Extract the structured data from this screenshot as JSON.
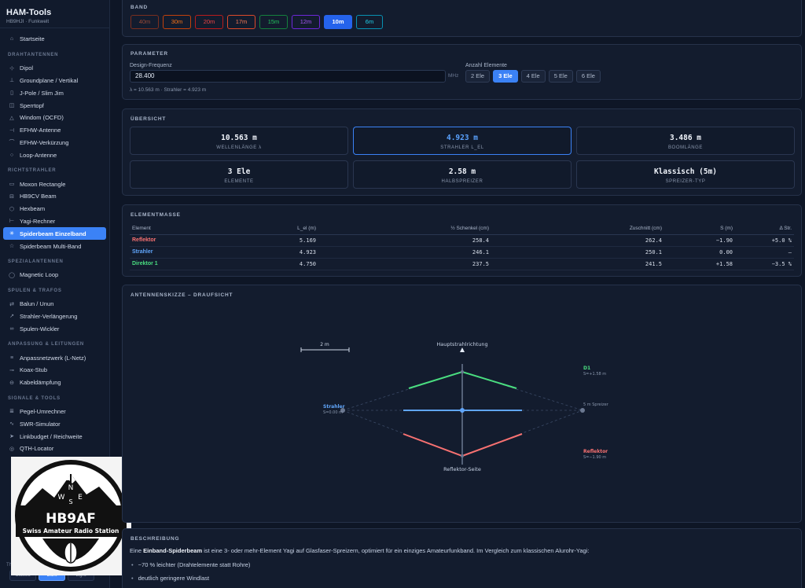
{
  "app": {
    "title": "HAM-Tools",
    "subtitle": "HB9HJI · Funkwelt"
  },
  "sidebar": {
    "home": "Startseite",
    "sections": [
      {
        "title": "DRAHTANTENNEN",
        "items": [
          {
            "label": "Dipol",
            "icon": "dipole-icon",
            "glyph": "⊹"
          },
          {
            "label": "Groundplane / Vertikal",
            "icon": "groundplane-icon",
            "glyph": "⊥"
          },
          {
            "label": "J-Pole / Slim Jim",
            "icon": "jpole-icon",
            "glyph": "▯"
          },
          {
            "label": "Sperrtopf",
            "icon": "sperrtopf-icon",
            "glyph": "◫"
          },
          {
            "label": "Windom (OCFD)",
            "icon": "windom-icon",
            "glyph": "△"
          },
          {
            "label": "EFHW-Antenne",
            "icon": "efhw-icon",
            "glyph": "⊣"
          },
          {
            "label": "EFHW-Verkürzung",
            "icon": "efhw-short-icon",
            "glyph": "⌒"
          },
          {
            "label": "Loop-Antenne",
            "icon": "loop-icon",
            "glyph": "○"
          }
        ]
      },
      {
        "title": "RICHTSTRAHLER",
        "items": [
          {
            "label": "Moxon Rectangle",
            "icon": "moxon-icon",
            "glyph": "▭"
          },
          {
            "label": "HB9CV Beam",
            "icon": "hb9cv-icon",
            "glyph": "⊟"
          },
          {
            "label": "Hexbeam",
            "icon": "hexbeam-icon",
            "glyph": "⬡"
          },
          {
            "label": "Yagi-Rechner",
            "icon": "yagi-icon",
            "glyph": "⊢"
          },
          {
            "label": "Spiderbeam Einzelband",
            "icon": "spiderbeam-icon",
            "glyph": "✳",
            "active": true
          },
          {
            "label": "Spiderbeam Multi-Band",
            "icon": "spiderbeam-multi-icon",
            "glyph": "☆"
          }
        ]
      },
      {
        "title": "SPEZIALANTENNEN",
        "items": [
          {
            "label": "Magnetic Loop",
            "icon": "magloop-icon",
            "glyph": "◯"
          }
        ]
      },
      {
        "title": "SPULEN & TRAFOS",
        "items": [
          {
            "label": "Balun / Unun",
            "icon": "balun-icon",
            "glyph": "⇄"
          },
          {
            "label": "Strahler-Verlängerung",
            "icon": "extension-icon",
            "glyph": "↗"
          },
          {
            "label": "Spulen-Wickler",
            "icon": "coil-icon",
            "glyph": "∞"
          }
        ]
      },
      {
        "title": "ANPASSUNG & LEITUNGEN",
        "items": [
          {
            "label": "Anpassnetzwerk (L-Netz)",
            "icon": "lnetwork-icon",
            "glyph": "≡"
          },
          {
            "label": "Koax-Stub",
            "icon": "coax-icon",
            "glyph": "⊸"
          },
          {
            "label": "Kabeldämpfung",
            "icon": "cable-icon",
            "glyph": "⊖"
          }
        ]
      },
      {
        "title": "SIGNALE & TOOLS",
        "items": [
          {
            "label": "Pegel-Umrechner",
            "icon": "level-icon",
            "glyph": "≣"
          },
          {
            "label": "SWR-Simulator",
            "icon": "swr-icon",
            "glyph": "∿"
          },
          {
            "label": "Linkbudget / Reichweite",
            "icon": "link-icon",
            "glyph": "➤"
          },
          {
            "label": "QTH-Locator",
            "icon": "locator-icon",
            "glyph": "◎"
          }
        ]
      }
    ],
    "theme": {
      "label": "Theme",
      "options": [
        "Classic",
        "Dark",
        "Light"
      ],
      "active": "Dark"
    }
  },
  "logo": {
    "callsign": "HB9AF",
    "caption": "Swiss Amateur Radio Station",
    "compass": [
      "N",
      "W",
      "E",
      "S"
    ]
  },
  "band": {
    "title": "BAND",
    "items": [
      {
        "label": "40m",
        "color": "#7a2f1f",
        "text": "#9a4a36"
      },
      {
        "label": "30m",
        "color": "#c2410c",
        "text": "#f97316"
      },
      {
        "label": "20m",
        "color": "#b91c1c",
        "text": "#ef4444"
      },
      {
        "label": "17m",
        "color": "#dc4a2a",
        "text": "#fb7a55"
      },
      {
        "label": "15m",
        "color": "#15803d",
        "text": "#22c55e"
      },
      {
        "label": "12m",
        "color": "#6d28d9",
        "text": "#a855f7"
      },
      {
        "label": "10m",
        "color": "#2563eb",
        "text": "#ffffff",
        "active": true
      },
      {
        "label": "6m",
        "color": "#0891b2",
        "text": "#22d3ee"
      }
    ]
  },
  "params": {
    "title": "PARAMETER",
    "freq_label": "Design-Frequenz",
    "freq_value": "28.400",
    "freq_unit": "MHz",
    "elements_label": "Anzahl Elemente",
    "elements": [
      "2 Ele",
      "3 Ele",
      "4 Ele",
      "5 Ele",
      "6 Ele"
    ],
    "elements_active": "3 Ele",
    "formula": "λ = 10.563 m · Strahler = 4.923 m"
  },
  "overview": {
    "title": "ÜBERSICHT",
    "tiles": [
      {
        "value": "10.563 m",
        "label": "WELLENLÄNGE λ"
      },
      {
        "value": "4.923 m",
        "label": "STRAHLER L_EL",
        "highlight": true
      },
      {
        "value": "3.486 m",
        "label": "BOOMLÄNGE"
      },
      {
        "value": "3 Ele",
        "label": "ELEMENTE"
      },
      {
        "value": "2.58 m",
        "label": "HALBSPREIZER"
      },
      {
        "value": "Klassisch (5m)",
        "label": "SPREIZER-TYP"
      }
    ]
  },
  "elements_table": {
    "title": "ELEMENTMASSE",
    "headers": [
      "Element",
      "L_el (m)",
      "½ Schenkel (cm)",
      "Zuschnitt (cm)",
      "S (m)",
      "Δ Str."
    ],
    "rows": [
      {
        "name": "Reflektor",
        "color": "#f87171",
        "cells": [
          "5.169",
          "258.4",
          "262.4",
          "−1.90",
          "+5.0 %"
        ]
      },
      {
        "name": "Strahler",
        "color": "#60a5fa",
        "cells": [
          "4.923",
          "246.1",
          "250.1",
          "0.00",
          "—"
        ]
      },
      {
        "name": "Direktor 1",
        "color": "#4ade80",
        "cells": [
          "4.750",
          "237.5",
          "241.5",
          "+1.58",
          "−3.5 %"
        ]
      }
    ]
  },
  "sketch": {
    "title": "ANTENNENSKIZZE – DRAUFSICHT",
    "scale_label": "2 m",
    "forward_label": "Hauptstrahlrichtung",
    "back_label": "Reflektor-Seite",
    "driven": {
      "name": "Strahler",
      "detail": "S=0.00 m",
      "color": "#60a5fa"
    },
    "director": {
      "name": "D1",
      "detail": "S=+1.58 m",
      "color": "#4ade80"
    },
    "reflector": {
      "name": "Reflektor",
      "detail": "S=−1.90 m",
      "color": "#f87171"
    },
    "spreader_label": "5 m Spreizer"
  },
  "description": {
    "title": "BESCHREIBUNG",
    "prefix": "Eine ",
    "bold": "Einband-Spiderbeam",
    "suffix": " ist eine 3- oder mehr-Element Yagi auf Glasfaser-Spreizern, optimiert für ein einziges Amateurfunkband. Im Vergleich zum klassischen Alurohr-Yagi:",
    "bullets": [
      "~70 % leichter (Drahtelemente statt Rohre)",
      "deutlich geringere Windlast"
    ]
  }
}
